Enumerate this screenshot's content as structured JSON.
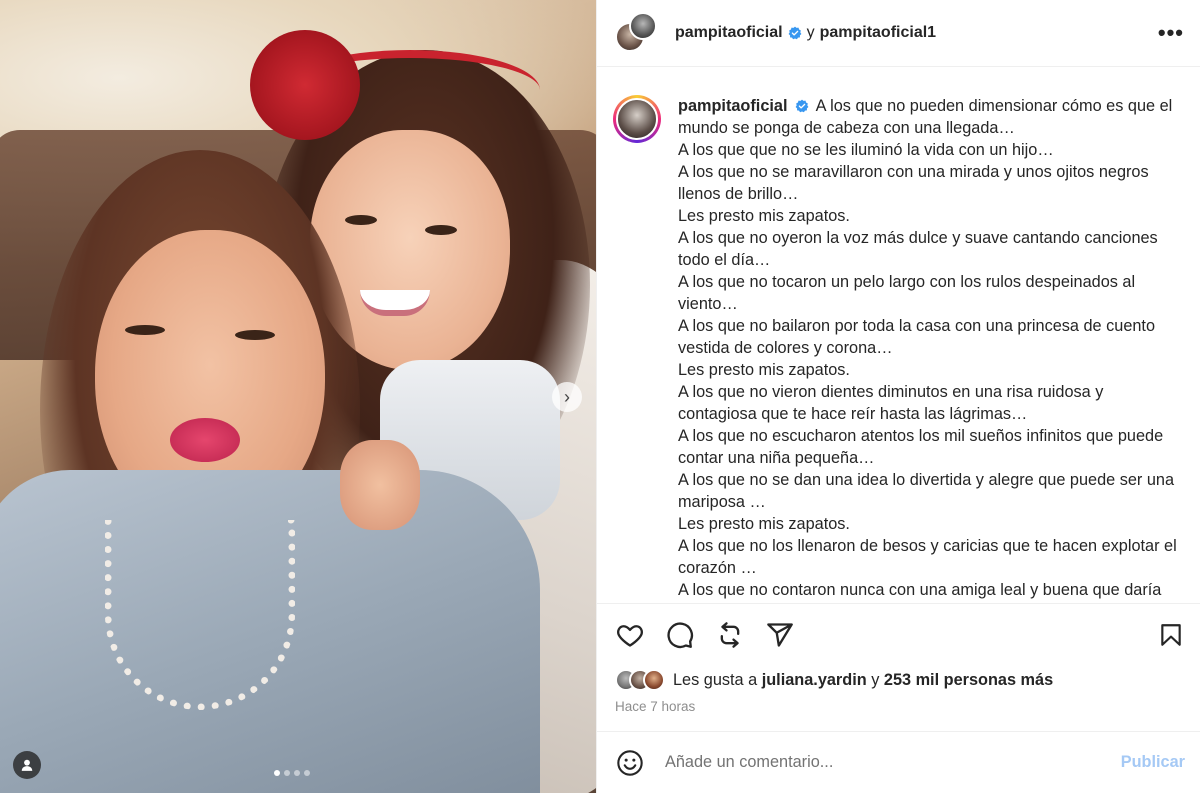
{
  "header": {
    "username": "pampitaoficial",
    "connector": "y",
    "collaborator": "pampitaoficial1",
    "more_label": "•••"
  },
  "post": {
    "carousel_next": "›",
    "carousel_dots": 4,
    "active_dot": 0
  },
  "caption": {
    "username": "pampitaoficial",
    "lines": [
      "A los que no pueden dimensionar cómo es que el mundo se ponga de cabeza con una llegada…",
      "A los que que no se les iluminó la vida con un hijo…",
      "A los que no se maravillaron con una mirada y unos ojitos negros llenos de brillo…",
      "Les presto mis zapatos.",
      "A los que no oyeron la voz más dulce y suave cantando canciones todo el día…",
      "A los que no tocaron un pelo largo con los rulos despeinados al viento…",
      "A los que no bailaron por toda la casa con una princesa de cuento vestida de colores y corona…",
      "Les presto mis zapatos.",
      "A los que no vieron dientes diminutos en una risa ruidosa y contagiosa que te hace reír hasta las lágrimas…",
      "A los que no escucharon atentos los mil sueños infinitos que puede contar una niña pequeña…",
      "A los que no se dan una idea lo divertida y alegre que puede ser una mariposa …",
      "Les presto mis zapatos.",
      "A los que no los llenaron de besos y caricias que te hacen explotar el corazón …",
      "A los que no contaron nunca con una amiga leal y buena que daría"
    ]
  },
  "likes": {
    "prefix": "Les gusta a",
    "liker": "juliana.yardin",
    "middle": "y",
    "count_text": "253 mil personas más"
  },
  "time_ago": "Hace 7 horas",
  "comment": {
    "placeholder": "Añade un comentario...",
    "publish_label": "Publicar"
  },
  "colors": {
    "verified": "#3897f0",
    "publish": "#a5c9f5",
    "muted": "#8e8e8e"
  }
}
